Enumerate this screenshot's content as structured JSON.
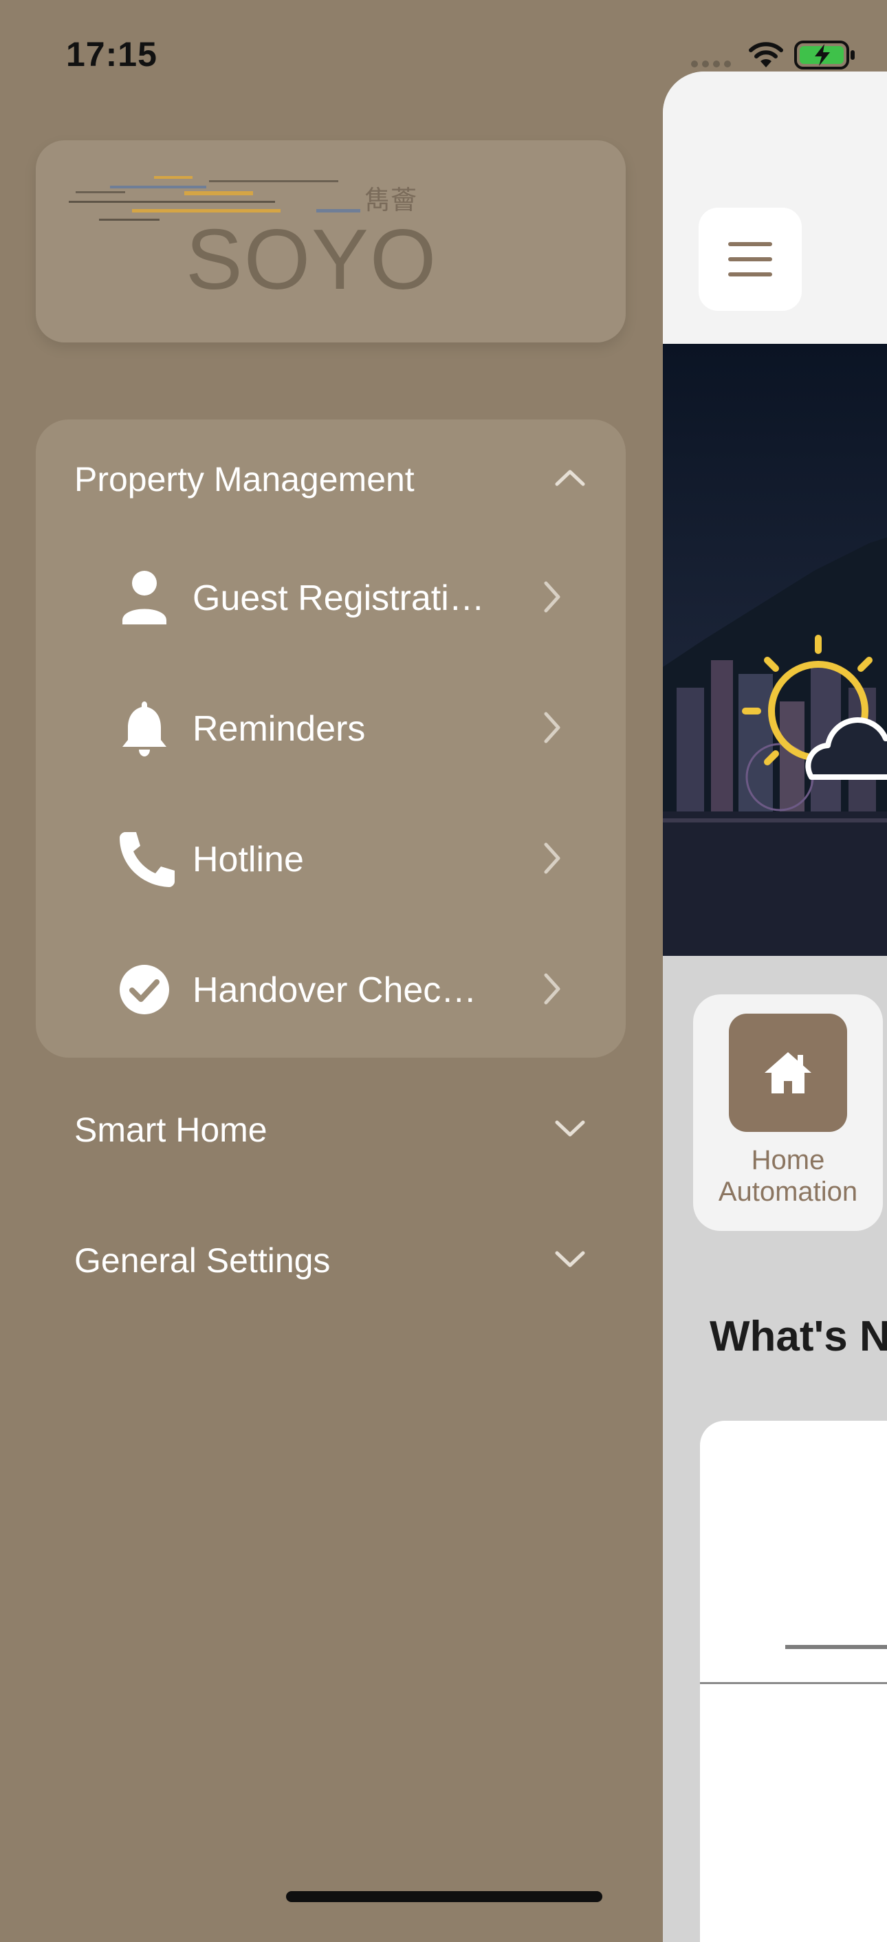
{
  "status_bar": {
    "time": "17:15",
    "battery_color": "#3fc14a"
  },
  "logo": {
    "text": "SOYO",
    "chinese_text": "雋薈",
    "accent_color": "#d5a545"
  },
  "drawer": {
    "sections": [
      {
        "label": "Property Management",
        "expanded": true,
        "items": [
          {
            "label": "Guest Registrati…",
            "icon": "person-icon"
          },
          {
            "label": "Reminders",
            "icon": "bell-icon"
          },
          {
            "label": "Hotline",
            "icon": "phone-icon"
          },
          {
            "label": "Handover Chec…",
            "icon": "check-circle-icon"
          }
        ]
      },
      {
        "label": "Smart Home",
        "expanded": false
      },
      {
        "label": "General Settings",
        "expanded": false
      }
    ]
  },
  "main": {
    "tiles": [
      {
        "label_line1": "Home",
        "label_line2": "Automation",
        "icon": "home-icon"
      }
    ],
    "whats_new_title": "What's N",
    "brand_color": "#8b7560"
  }
}
